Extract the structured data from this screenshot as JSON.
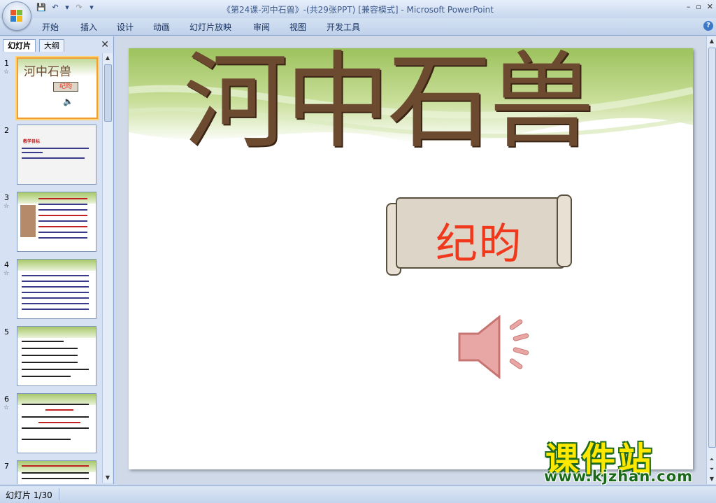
{
  "window": {
    "title": "《第24课-河中石兽》-(共29张PPT) [兼容模式] - Microsoft PowerPoint",
    "controls": [
      "–",
      "▫",
      "✕"
    ]
  },
  "ribbon": {
    "tabs": [
      "开始",
      "插入",
      "设计",
      "动画",
      "幻灯片放映",
      "审阅",
      "视图",
      "开发工具"
    ]
  },
  "panel": {
    "tabs": [
      "幻灯片",
      "大纲"
    ],
    "thumbnails": [
      {
        "num": "1",
        "star": "☆",
        "title": "河中石兽",
        "label": "纪昀"
      },
      {
        "num": "2",
        "star": "",
        "title": "教学目标"
      },
      {
        "num": "3",
        "star": "☆",
        "title": ""
      },
      {
        "num": "4",
        "star": "☆",
        "title": ""
      },
      {
        "num": "5",
        "star": "",
        "title": ""
      },
      {
        "num": "6",
        "star": "☆",
        "title": ""
      },
      {
        "num": "7",
        "star": "",
        "title": ""
      }
    ]
  },
  "slide": {
    "title": "河中石兽",
    "author": "纪昀"
  },
  "status": {
    "slide_count": "幻灯片 1/30"
  },
  "watermark": {
    "text": "课件站",
    "url": "www.kjzhan.com"
  }
}
